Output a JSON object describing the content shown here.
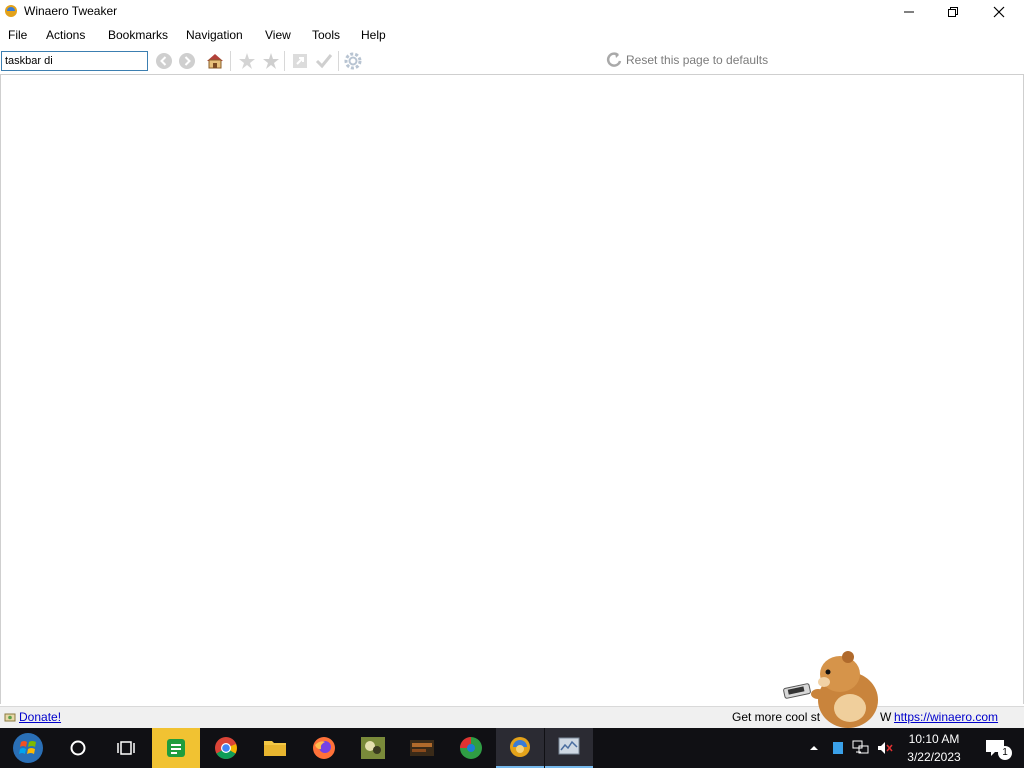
{
  "window": {
    "title": "Winaero Tweaker"
  },
  "menu": [
    "File",
    "Actions",
    "Bookmarks",
    "Navigation",
    "View",
    "Tools",
    "Help"
  ],
  "toolbar": {
    "search_value": "taskbar di",
    "reset_label": "Reset this page to defaults",
    "icons": [
      "back-icon",
      "forward-icon",
      "home-icon",
      "add-bookmark-icon",
      "bookmark-star-icon",
      "open-icon",
      "apply-check-icon",
      "settings-gear-icon"
    ]
  },
  "status": {
    "donate_label": "Donate!",
    "get_more_text": "Get more cool st",
    "w_fragment": "W",
    "site_link": "https://winaero.com"
  },
  "taskbar": {
    "apps": [
      "start-button",
      "search-button",
      "task-view-button",
      "notes-app",
      "chrome-app",
      "file-explorer-app",
      "firefox-app",
      "game-app",
      "video-app",
      "app-red-green",
      "winaero-tweaker-app",
      "system-app"
    ],
    "time": "10:10 AM",
    "date": "3/22/2023",
    "notification_count": "1"
  },
  "colors": {
    "accent": "#3c7fb1",
    "link": "#0000cc",
    "taskbar": "#101014"
  }
}
